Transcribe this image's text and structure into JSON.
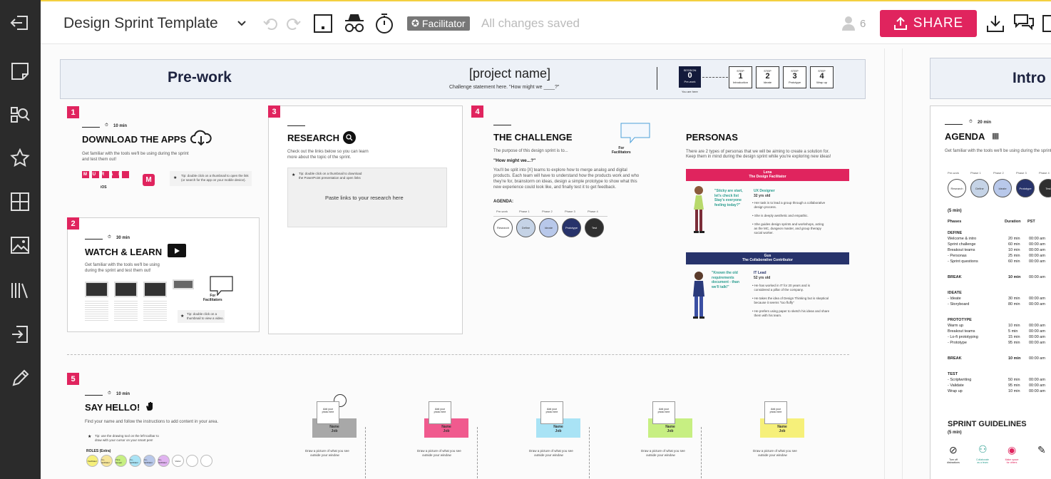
{
  "app": {
    "title": "Design Sprint Template",
    "facilitator": "Facilitator",
    "status": "All changes saved",
    "user_count": "6",
    "share_label": "SHARE"
  },
  "prework": {
    "title": "Pre-work",
    "project": "[project name]",
    "challenge": "Challenge statement here. \"How might we ____?\"",
    "session_label": "SESSION",
    "session_num": "0",
    "session_name": "Pre-work",
    "you_are_here": "You are here",
    "steps": [
      {
        "label": "STEP",
        "num": "1",
        "name": "Introduction"
      },
      {
        "label": "STEP",
        "num": "2",
        "name": "Ideate"
      },
      {
        "label": "STEP",
        "num": "3",
        "name": "Prototype"
      },
      {
        "label": "STEP",
        "num": "4",
        "name": "Wrap up"
      }
    ]
  },
  "intro_title": "Intro",
  "section1": {
    "num": "1",
    "time": "10 min",
    "title": "DOWNLOAD THE APPS",
    "desc1": "Get familiar with the tools we'll be using during the sprint",
    "desc2": "and test them out!",
    "brand": "MURAL",
    "ios": "iOS",
    "tip1": "Tip: double click on a thumbnail to open the link",
    "tip2": "(or search for the app on your mobile device)."
  },
  "section2": {
    "num": "2",
    "time": "30 min",
    "title": "WATCH & LEARN",
    "desc1": "Get familiar with the tools we'll be using",
    "desc2": "during the sprint and test them out!",
    "for": "For",
    "facilitators": "Facilitators",
    "tip1": "Tip: double click on a",
    "tip2": "thumbnail to view a video."
  },
  "section3": {
    "num": "3",
    "title": "RESEARCH",
    "desc1": "Check out the links below so you can learn",
    "desc2": "more about the topic of the sprint.",
    "tip1": "Tip: double click on a thumbnail to download",
    "tip2": "the PowerPoint presentation and open links",
    "paste": "Paste links to your research here"
  },
  "section4": {
    "num": "4",
    "title": "THE CHALLENGE",
    "desc": "The purpose of this design sprint is to...",
    "hmw": "\"How might we...?\"",
    "p1": "You'll be split into [X] teams to explore how to merge analog and digital",
    "p2": "products. Each team will have to understand how the products work and who",
    "p3": "they're for, brainstorm on ideas, design a simple prototype to show what this",
    "p4": "new experience could look like, and finally test it to get feedback.",
    "agenda": "AGENDA:",
    "for": "For",
    "facilitators": "Facilitators",
    "phases": [
      "Pre-work",
      "Phase 1",
      "Phase 2",
      "Phase 3",
      "Phase 4"
    ],
    "circles": [
      {
        "label": "Research",
        "color": "#ffffff",
        "text": "#333"
      },
      {
        "label": "Define",
        "color": "#c5d3e6",
        "text": "#333"
      },
      {
        "label": "Ideate",
        "color": "#b8c8ea",
        "text": "#333"
      },
      {
        "label": "Prototype",
        "color": "#27336b",
        "text": "#fff"
      },
      {
        "label": "Test",
        "color": "#2f2f2f",
        "text": "#fff"
      }
    ]
  },
  "personas": {
    "title": "PERSONAS",
    "desc1": "There are 2 types of personas that we will be aiming to create a solution for.",
    "desc2": "Keep them in mind during the design sprint while you're exploring new ideas!",
    "p1": {
      "name": "Lena",
      "role": "The Design Facilitator",
      "quote1": "\"Sticky are start,",
      "quote2": "let's check list",
      "quote3": "Stay's everyone",
      "quote4": "feeling today?\"",
      "job": "UX Designer",
      "age": "32 yrs old",
      "b1": "Her task is to lead a group through a collaborative",
      "b1b": "design process.",
      "b2": "She is deeply aesthetic and empathic.",
      "b3": "She guides design sprints and workshops, acting",
      "b3b": "as the MC, dungeon master, and group therapy",
      "b3c": "social worker."
    },
    "p2": {
      "name": "Gus",
      "role": "The Collaborative Contributor",
      "quote1": "\"Known the old",
      "quote2": "requirements",
      "quote3": "document - than",
      "quote4": "we'll talk!\"",
      "job": "IT Lead",
      "age": "52 yrs old",
      "b1": "He has worked in IT for 20 years and is",
      "b1b": "considered a pillar of the company.",
      "b2": "He takes the idea of Design Thinking but is skeptical",
      "b2b": "because it seems \"too fluffy\"",
      "b3": "He prefers using paper to sketch his ideas and share",
      "b3b": "them with his team."
    }
  },
  "section5": {
    "num": "5",
    "time": "10 min",
    "title": "SAY HELLO!",
    "desc": "Find your name and follow the instructions to add content in your area.",
    "tip1": "Tip: use the drawing tool on the left toolbar to",
    "tip2": "draw with your cursor on your smart pen!",
    "roles": "ROLES (Extra)",
    "roles_list": [
      "Facilitator",
      "Co-facilitator",
      "Time keeper",
      "Co-facilitator",
      "Co-facilitator",
      "Co-facilitator",
      "Visitor",
      "",
      ""
    ],
    "add_photo1": "Add your",
    "add_photo2": "photo here",
    "name": "Name",
    "job": "Job",
    "draw1": "Draw a picture of what you see",
    "draw2": "outside your window",
    "cards": [
      {
        "color": "#a8a8a8"
      },
      {
        "color": "#f05a8e"
      },
      {
        "color": "#a9e3f5"
      },
      {
        "color": "#c7ef82"
      },
      {
        "color": "#f6f07a"
      }
    ]
  },
  "agenda": {
    "time": "20 min",
    "title": "AGENDA",
    "desc": "Get familiar with the tools we'll be using during the sprint",
    "phases": [
      "Pre-work",
      "Phase 1",
      "Phase 2",
      "Phase 3",
      "Phase 4"
    ],
    "circles": [
      {
        "label": "Research",
        "color": "#ffffff",
        "text": "#333"
      },
      {
        "label": "Define",
        "color": "#c5d3e6",
        "text": "#333"
      },
      {
        "label": "Ideate",
        "color": "#b8c8ea",
        "text": "#333"
      },
      {
        "label": "Prototype",
        "color": "#27336b",
        "text": "#fff"
      },
      {
        "label": "Test",
        "color": "#2f2f2f",
        "text": "#fff"
      }
    ],
    "min5": "(5 min)",
    "h_phases": "Phases",
    "h_duration": "Duration",
    "h_pst": "PST",
    "define": "DEFINE",
    "r1": "Welcome & intro",
    "d1": "20 min",
    "t1": "00:00 am",
    "r2": "Sprint challenge",
    "d2": "60 min",
    "t2": "00:00 am",
    "r3": "Breakout teams",
    "d3": "10 min",
    "t3": "00:00 am",
    "r4": "- Personas",
    "d4": "25 min",
    "t4": "00:00 am",
    "r5": "- Sprint questions",
    "d5": "60 min",
    "t5": "00:00 am",
    "break": "BREAK",
    "bd": "10 min",
    "bt": "00:00 am",
    "ideate": "IDEATE",
    "i1": "- Ideate",
    "id1": "30 min",
    "it1": "00:00 am",
    "i2": "- Storyboard",
    "id2": "80 min",
    "it2": "00:00 am",
    "prototype": "PROTOTYPE",
    "p1": "Warm up",
    "pd1": "10 min",
    "pt1": "00:00 am",
    "p2": "Breakout teams",
    "pd2": "5 min",
    "pt2": "00:00 am",
    "p3": "- Lo-fi prototyping",
    "pd3": "15 min",
    "pt3": "00:00 am",
    "p4": "- Prototype",
    "pd4": "95 min",
    "pt4": "00:00 am",
    "break2": "BREAK",
    "b2d": "10 min",
    "b2t": "00:00 am",
    "test": "TEST",
    "te1": "- Scriptwriting",
    "ted1": "50 min",
    "tet1": "00:00 am",
    "te2": "- Validate",
    "ted2": "95 min",
    "tet2": "00:00 am",
    "te3": "Wrap up",
    "ted3": "10 min",
    "tet3": "00:00 am",
    "guidelines": "SPRINT GUIDELINES",
    "gmin": "(5 min)",
    "g1": "Turn off",
    "g1b": "distractions",
    "g2": "Collaborate",
    "g2b": "as a team",
    "g3": "Make space",
    "g3b": "for others"
  }
}
